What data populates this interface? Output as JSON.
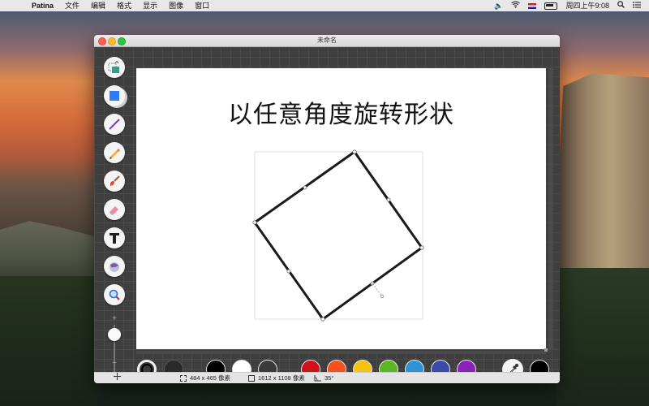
{
  "menubar": {
    "app_name": "Patina",
    "menus": [
      "文件",
      "编辑",
      "格式",
      "显示",
      "图像",
      "窗口"
    ],
    "clock": "周四上午9:08"
  },
  "window": {
    "title": "未命名"
  },
  "tools": [
    "select-tool",
    "shape-tool",
    "line-tool",
    "pencil-tool",
    "brush-tool",
    "eraser-tool",
    "text-tool",
    "fill-tool",
    "zoom-tool"
  ],
  "zoom_controls": {
    "plus": "+",
    "minus": "−"
  },
  "canvas": {
    "title": "以任意角度旋转形状",
    "shape": "rotated-square",
    "rotation_degrees": 35
  },
  "palette": {
    "stroke_color": "#000000",
    "fill_color": "#2a2a2a",
    "swatches": [
      "#000000",
      "#ffffff",
      "#3a3a3a",
      "#d0111b",
      "#f4511e",
      "#f5c211",
      "#5cb524",
      "#2e93d6",
      "#3c4aa8",
      "#8a24b8"
    ],
    "current_color": "#000000"
  },
  "status": {
    "selection_size": "484 x 465 像素",
    "canvas_size": "1612 x 1108 像素",
    "angle": "35°"
  }
}
